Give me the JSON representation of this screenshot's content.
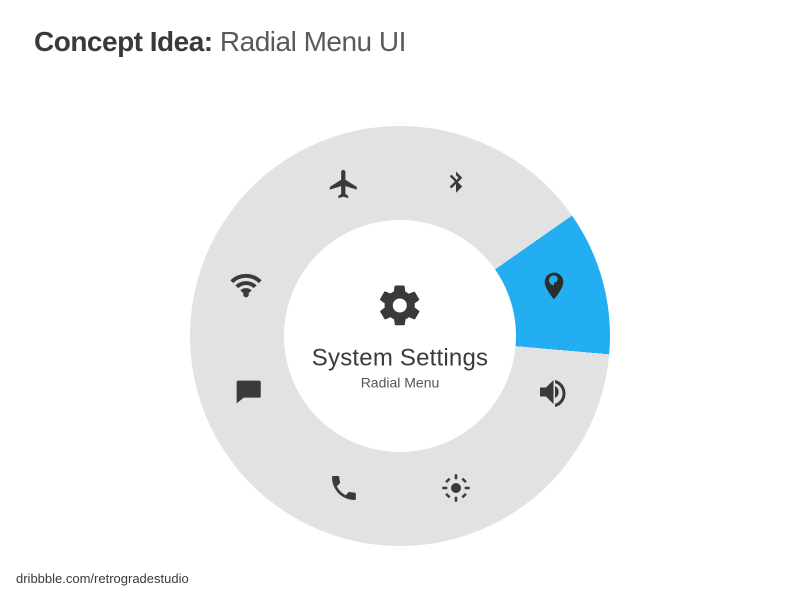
{
  "header": {
    "title_bold": "Concept Idea:",
    "title_light": " Radial Menu UI"
  },
  "credit": "dribbble.com/retrogradestudio",
  "center": {
    "title": "System Settings",
    "subtitle": "Radial Menu",
    "icon": "gear-icon"
  },
  "colors": {
    "ring": "#e1e2e4",
    "highlight": "#23aef2",
    "icon": "#3a3a3a"
  },
  "menu": {
    "highlighted_index": 2,
    "items": [
      {
        "name": "airplane-mode",
        "icon": "airplane-icon"
      },
      {
        "name": "bluetooth",
        "icon": "bluetooth-icon"
      },
      {
        "name": "location",
        "icon": "location-pin-icon"
      },
      {
        "name": "sound",
        "icon": "speaker-icon"
      },
      {
        "name": "brightness",
        "icon": "brightness-icon"
      },
      {
        "name": "phone",
        "icon": "phone-icon"
      },
      {
        "name": "messages",
        "icon": "chat-icon"
      },
      {
        "name": "wifi",
        "icon": "wifi-icon"
      }
    ]
  }
}
